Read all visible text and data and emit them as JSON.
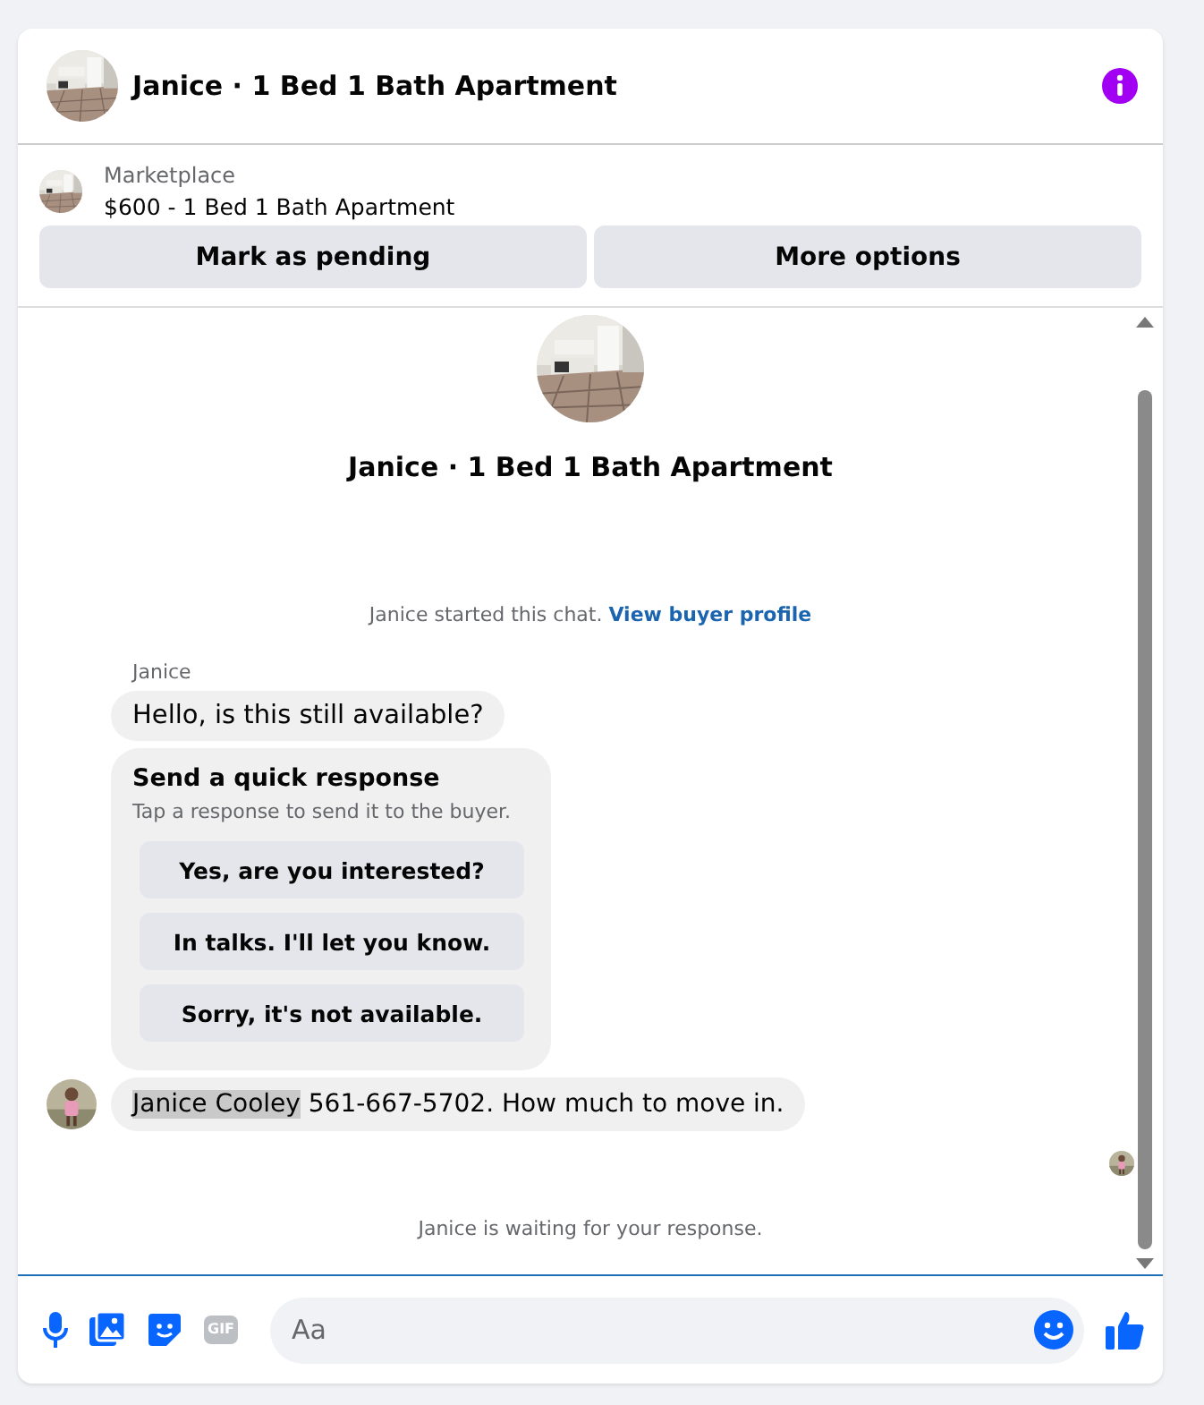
{
  "header": {
    "title": "Janice · 1 Bed 1 Bath Apartment"
  },
  "listing": {
    "source": "Marketplace",
    "title": "$600 - 1 Bed 1 Bath Apartment",
    "buttons": [
      "Mark as pending",
      "More options"
    ]
  },
  "chat": {
    "title": "Janice · 1 Bed 1 Bath Apartment",
    "started_text": "Janice started this chat.",
    "profile_link": "View buyer profile",
    "sender": "Janice",
    "first_message": "Hello, is this still available?",
    "quick_response": {
      "title": "Send a quick response",
      "hint": "Tap a response to send it to the buyer.",
      "options": [
        "Yes, are you interested?",
        "In talks. I'll let you know.",
        "Sorry, it's not available."
      ]
    },
    "last_message": {
      "highlighted": "Janice Cooley",
      "text": " 561-667-5702. How much to move in."
    },
    "status": "Janice is waiting for your response."
  },
  "composer": {
    "placeholder": "Aa",
    "gif_label": "GIF"
  }
}
